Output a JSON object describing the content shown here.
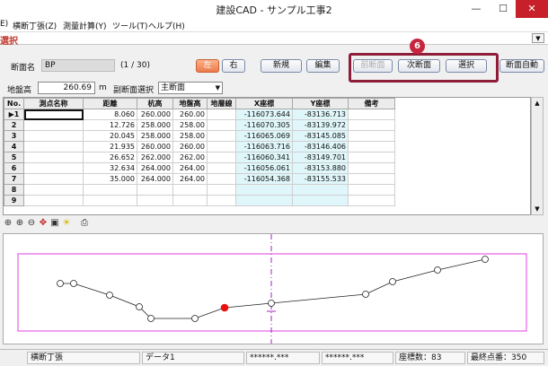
{
  "window": {
    "title": "建設CAD - サンプル工事2",
    "minimize": "—",
    "maximize": "☐",
    "close": "✕"
  },
  "menu": [
    "E)",
    "横断丁張(Z)",
    "測量計算(Y)",
    "ツール(T)",
    "ヘルプ(H)"
  ],
  "panel": {
    "title": "選択",
    "dropdown": "▼"
  },
  "section": {
    "label": "断面名",
    "name": "BP",
    "counter": "(1 / 30)"
  },
  "buttons": {
    "left": "左",
    "right": "右",
    "new": "新規",
    "edit": "編集",
    "prev": "前断面",
    "next": "次断面",
    "select": "選択",
    "auto": "断面自動"
  },
  "badge": "6",
  "ground": {
    "label": "地盤高",
    "value": "260.69",
    "unit": "m",
    "sub_label": "副断面選択",
    "sub_value": "主断面"
  },
  "table": {
    "headers": [
      "No.",
      "測点名称",
      "距離",
      "杭高",
      "地盤高",
      "地層線",
      "X座標",
      "Y座標",
      "備考"
    ],
    "rows": [
      [
        "▶1",
        "",
        "8.060",
        "260.000",
        "260.00",
        "",
        "-116073.644",
        "-83136.713",
        ""
      ],
      [
        "2",
        "",
        "12.726",
        "258.000",
        "258.00",
        "",
        "-116070.305",
        "-83139.972",
        ""
      ],
      [
        "3",
        "",
        "20.045",
        "258.000",
        "258.00",
        "",
        "-116065.069",
        "-83145.085",
        ""
      ],
      [
        "4",
        "",
        "21.935",
        "260.000",
        "260.00",
        "",
        "-116063.716",
        "-83146.406",
        ""
      ],
      [
        "5",
        "",
        "26.652",
        "262.000",
        "262.00",
        "",
        "-116060.341",
        "-83149.701",
        ""
      ],
      [
        "6",
        "",
        "32.634",
        "264.000",
        "264.00",
        "",
        "-116056.061",
        "-83153.880",
        ""
      ],
      [
        "7",
        "",
        "35.000",
        "264.000",
        "264.00",
        "",
        "-116054.368",
        "-83155.533",
        ""
      ],
      [
        "8",
        "",
        "",
        "",
        "",
        "",
        "",
        "",
        ""
      ],
      [
        "9",
        "",
        "",
        "",
        "",
        "",
        "",
        "",
        ""
      ]
    ]
  },
  "toolbar_icons": [
    "zoom-in",
    "zoom-in-alt",
    "zoom-out",
    "pan",
    "fit",
    "light",
    "print"
  ],
  "status": [
    "横断丁張",
    "データ1",
    "******.***",
    "******.***",
    "座標数：83",
    "最終点番：350"
  ]
}
